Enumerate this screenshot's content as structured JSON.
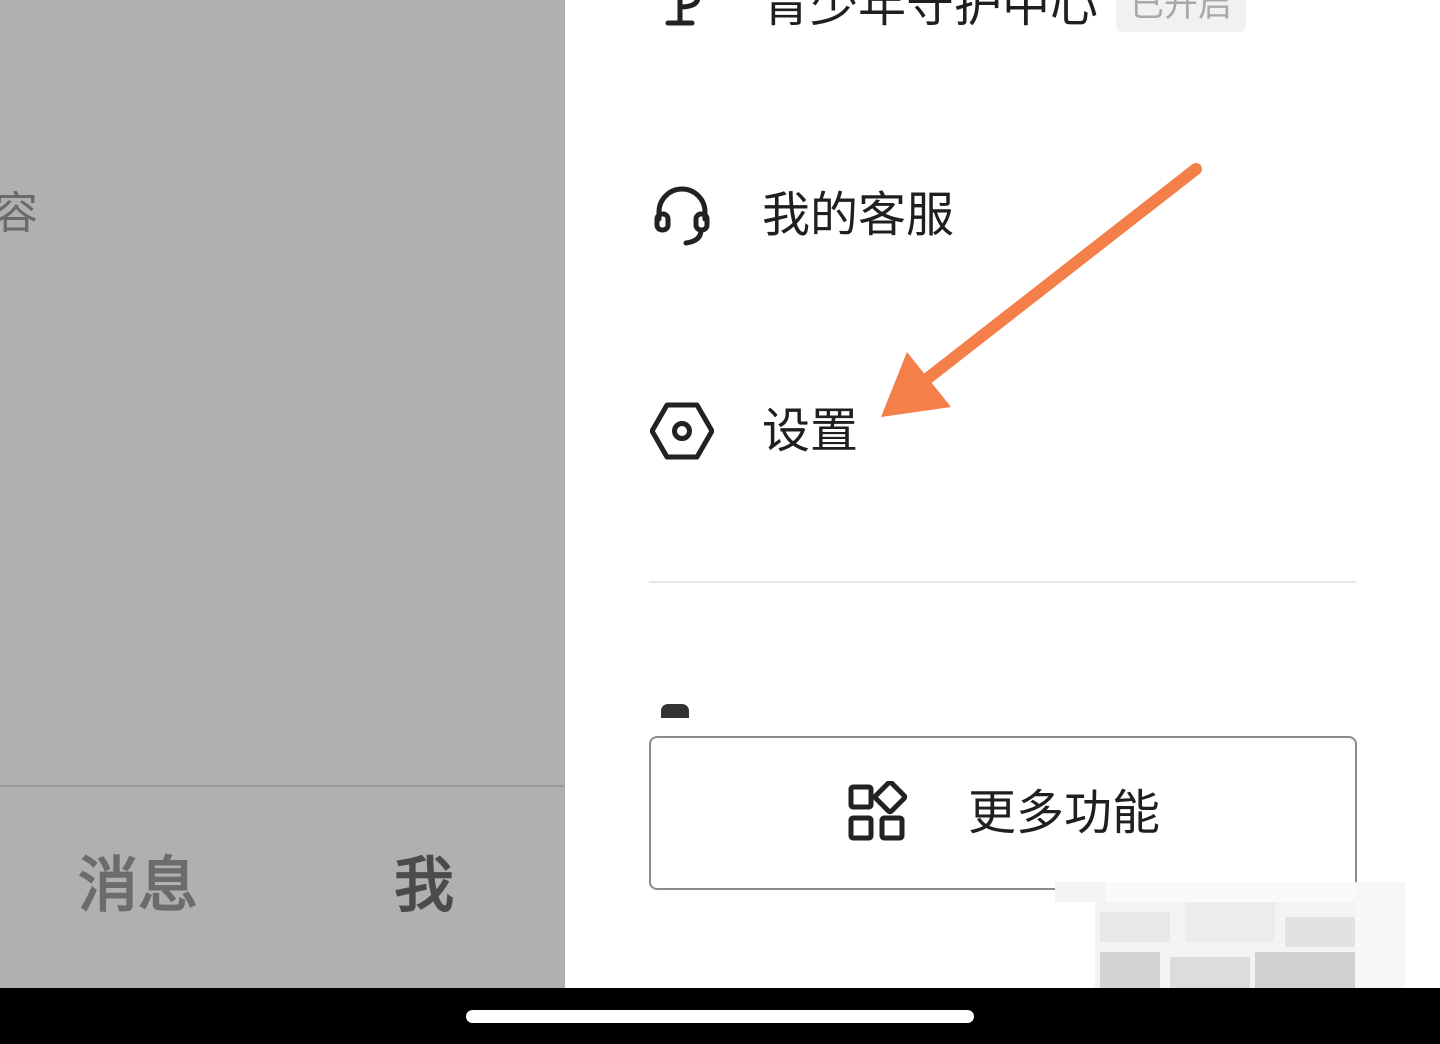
{
  "background_page": {
    "partial_text": "容",
    "tabs": {
      "messages": "消息",
      "me": "我"
    }
  },
  "drawer": {
    "items": [
      {
        "label": "青少年守护中心",
        "badge": "已开启",
        "icon": "youth-protection-icon"
      },
      {
        "label": "我的客服",
        "icon": "headset-icon"
      },
      {
        "label": "设置",
        "icon": "settings-hexagon-icon"
      }
    ],
    "more_button": {
      "label": "更多功能",
      "icon": "grid-apps-icon"
    }
  },
  "annotation": {
    "color": "#F47F48"
  },
  "colors": {
    "overlay": "#B0B0B0",
    "drawer": "#FFFFFF",
    "text": "#1F1F1F"
  }
}
